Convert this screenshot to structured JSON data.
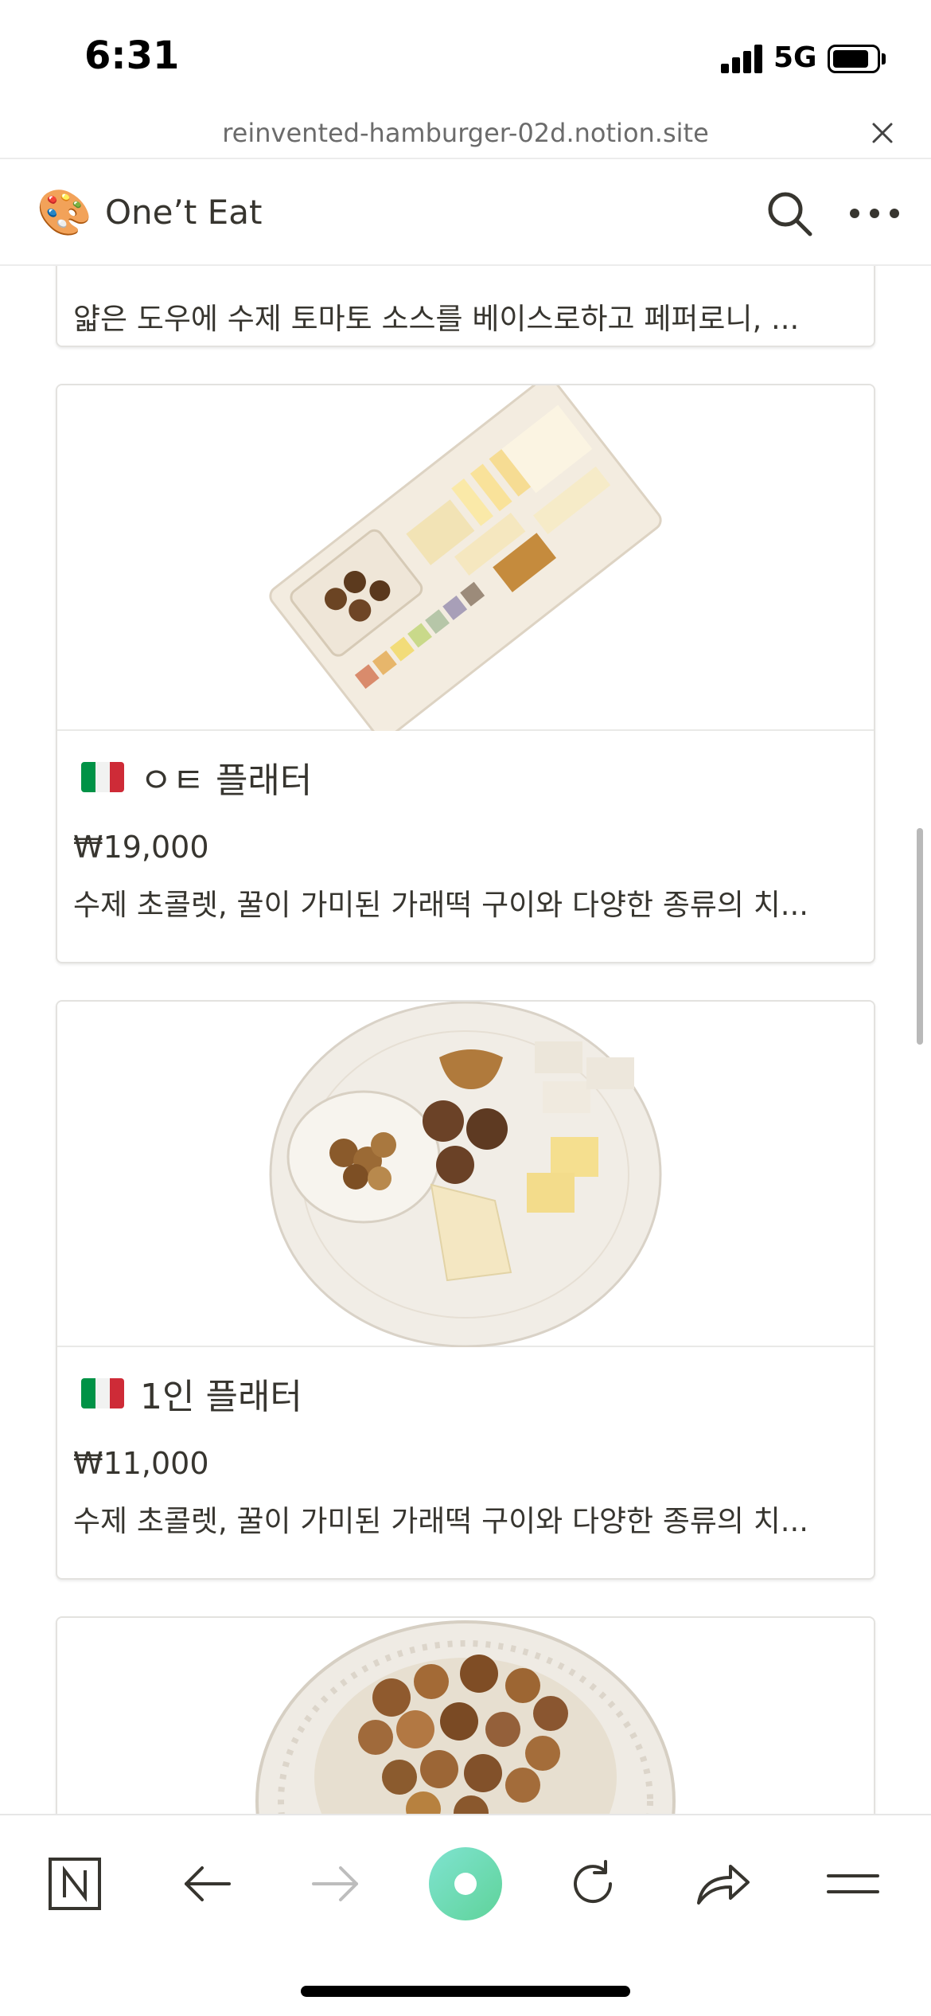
{
  "status_bar": {
    "time": "6:31",
    "network": "5G"
  },
  "browser": {
    "url": "reinvented-hamburger-02d.notion.site",
    "close_icon": "close-icon"
  },
  "header": {
    "logo_emoji": "🎨",
    "title": "One’t Eat",
    "icons": [
      "search-icon",
      "more-icon"
    ]
  },
  "cards": [
    {
      "description": "얇은 도우에 수제 토마토 소스를 베이스로하고 페퍼로니, ..."
    },
    {
      "title": "ㅇㅌ 플래터",
      "price": "₩19,000",
      "description": "수제 초콜렛, 꿀이 가미된 가래떡 구이와 다양한 종류의 치..."
    },
    {
      "title": "1인 플래터",
      "price": "₩11,000",
      "description": "수제 초콜렛, 꿀이 가미된 가래떡 구이와 다양한 종류의 치..."
    }
  ],
  "toolbar": {
    "icons": [
      "notion-icon",
      "back-arrow-icon",
      "forward-arrow-icon",
      "assistant-orb-icon",
      "reload-icon",
      "share-icon",
      "menu-icon"
    ]
  },
  "colors": {
    "text": "#37352f",
    "border": "#e3e2df",
    "muted": "#6b6b6b",
    "orb_green": "#5fd39a",
    "orb_teal": "#7fe3d0"
  }
}
